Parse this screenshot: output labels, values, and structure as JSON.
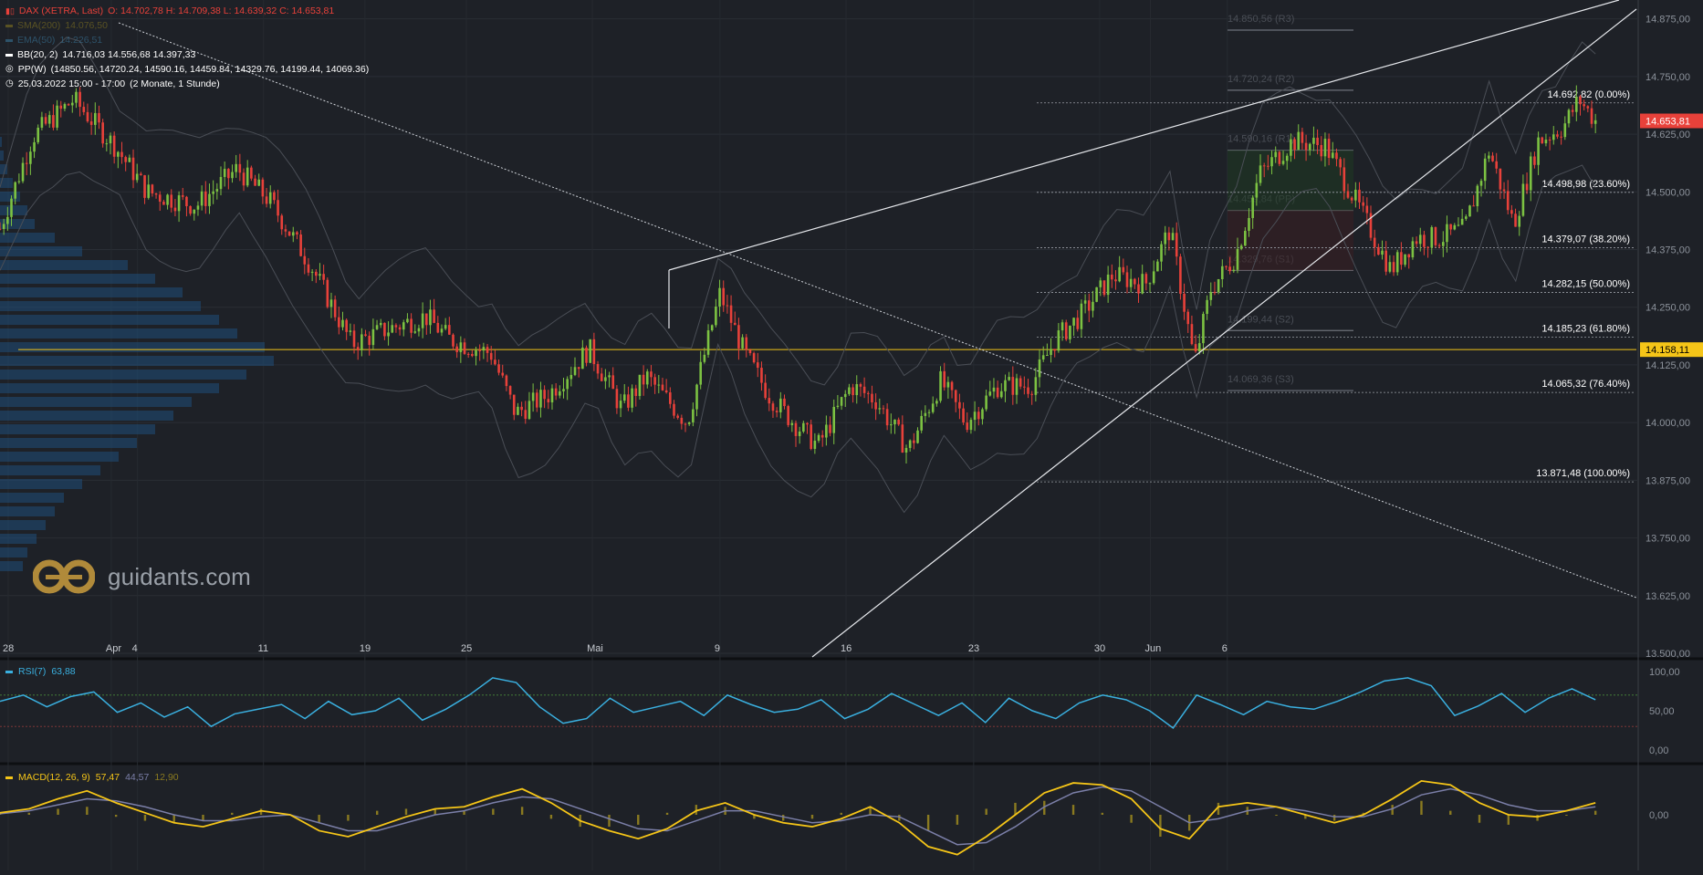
{
  "header": {
    "symbol_line": "DAX (XETRA, Last)",
    "ohlc": "O: 14.702,78  H: 14.709,38  L: 14.639,32  C: 14.653,81",
    "sma": {
      "label": "SMA(200)",
      "value": "14.076,50"
    },
    "ema": {
      "label": "EMA(50)",
      "value": "14.226,51"
    },
    "bb": {
      "label": "BB(20, 2)",
      "value": "14.716,03  14.556,68  14.397,33"
    },
    "pp": {
      "label": "PP(W)",
      "value": "(14850.56, 14720.24, 14590.16, 14459.84, 14329.76, 14199.44, 14069.36)"
    },
    "range": {
      "label": "25.03.2022 15:00 - 17:00",
      "value": "(2 Monate, 1 Stunde)"
    }
  },
  "logo": {
    "text": "guidants.com"
  },
  "colors": {
    "bg": "#1e2127",
    "up": "#7cc242",
    "down": "#e8413a",
    "accent": "#f5c518",
    "rsi": "#3ab0e0",
    "macd": "#f5c518",
    "signal": "#7b7fa8",
    "last_price": "#e8413a"
  },
  "chart_data": [
    {
      "type": "candlestick",
      "title": "DAX (XETRA, Last)",
      "ylim": [
        13500,
        14900
      ],
      "y_ticks": [
        "14.875,00",
        "14.750,00",
        "14.625,00",
        "14.500,00",
        "14.375,00",
        "14.250,00",
        "14.125,00",
        "14.000,00",
        "13.875,00",
        "13.750,00",
        "13.625,00",
        "13.500,00"
      ],
      "x_ticks": [
        {
          "label": "28",
          "pos": 0.005
        },
        {
          "label": "Apr",
          "pos": 0.068
        },
        {
          "label": "4",
          "pos": 0.084
        },
        {
          "label": "11",
          "pos": 0.161
        },
        {
          "label": "19",
          "pos": 0.223
        },
        {
          "label": "25",
          "pos": 0.285
        },
        {
          "label": "Mai",
          "pos": 0.362
        },
        {
          "label": "9",
          "pos": 0.44
        },
        {
          "label": "16",
          "pos": 0.517
        },
        {
          "label": "23",
          "pos": 0.595
        },
        {
          "label": "30",
          "pos": 0.672
        },
        {
          "label": "Jun",
          "pos": 0.703
        },
        {
          "label": "6",
          "pos": 0.75
        }
      ],
      "last_price": "14.653,81",
      "horizontal_level": "14.158,11",
      "fibonacci": [
        {
          "label": "14.692,82 (0.00%)",
          "value": 14692.82
        },
        {
          "label": "14.498,98 (23.60%)",
          "value": 14498.98
        },
        {
          "label": "14.379,07 (38.20%)",
          "value": 14379.07
        },
        {
          "label": "14.282,15 (50.00%)",
          "value": 14282.15
        },
        {
          "label": "14.185,23 (61.80%)",
          "value": 14185.23
        },
        {
          "label": "14.065,32 (76.40%)",
          "value": 14065.32
        },
        {
          "label": "13.871,48 (100.00%)",
          "value": 13871.48
        }
      ],
      "pivots": [
        {
          "label": "14.850,56 (R3)",
          "value": 14850.56
        },
        {
          "label": "14.720,24 (R2)",
          "value": 14720.24
        },
        {
          "label": "14.590,16 (R1)",
          "value": 14590.16
        },
        {
          "label": "14.459,84 (PP)",
          "value": 14459.84
        },
        {
          "label": "14.329,76 (S1)",
          "value": 14329.76
        },
        {
          "label": "14.199,44 (S2)",
          "value": 14199.44
        },
        {
          "label": "14.069,36 (S3)",
          "value": 14069.36
        }
      ],
      "series": [
        {
          "name": "Close",
          "points": [
            [
              0,
              14420
            ],
            [
              0.02,
              14620
            ],
            [
              0.045,
              14700
            ],
            [
              0.07,
              14600
            ],
            [
              0.09,
              14500
            ],
            [
              0.12,
              14470
            ],
            [
              0.145,
              14550
            ],
            [
              0.165,
              14480
            ],
            [
              0.19,
              14340
            ],
            [
              0.215,
              14170
            ],
            [
              0.235,
              14200
            ],
            [
              0.26,
              14230
            ],
            [
              0.275,
              14180
            ],
            [
              0.3,
              14150
            ],
            [
              0.315,
              14020
            ],
            [
              0.335,
              14060
            ],
            [
              0.36,
              14160
            ],
            [
              0.38,
              14030
            ],
            [
              0.395,
              14100
            ],
            [
              0.42,
              14000
            ],
            [
              0.44,
              14280
            ],
            [
              0.455,
              14150
            ],
            [
              0.47,
              14060
            ],
            [
              0.485,
              14000
            ],
            [
              0.5,
              13950
            ],
            [
              0.52,
              14080
            ],
            [
              0.535,
              14050
            ],
            [
              0.555,
              13940
            ],
            [
              0.575,
              14090
            ],
            [
              0.59,
              14000
            ],
            [
              0.61,
              14080
            ],
            [
              0.63,
              14080
            ],
            [
              0.645,
              14180
            ],
            [
              0.66,
              14230
            ],
            [
              0.68,
              14320
            ],
            [
              0.7,
              14300
            ],
            [
              0.715,
              14420
            ],
            [
              0.73,
              14130
            ],
            [
              0.74,
              14290
            ],
            [
              0.755,
              14360
            ],
            [
              0.77,
              14540
            ],
            [
              0.79,
              14610
            ],
            [
              0.81,
              14600
            ],
            [
              0.83,
              14470
            ],
            [
              0.85,
              14330
            ],
            [
              0.865,
              14400
            ],
            [
              0.88,
              14400
            ],
            [
              0.895,
              14420
            ],
            [
              0.91,
              14590
            ],
            [
              0.925,
              14430
            ],
            [
              0.94,
              14610
            ],
            [
              0.955,
              14640
            ],
            [
              0.965,
              14700
            ],
            [
              0.975,
              14654
            ]
          ]
        }
      ]
    },
    {
      "type": "line",
      "title": "RSI(7)",
      "value_label": "63,88",
      "ylim": [
        0,
        100
      ],
      "y_ticks": [
        "100,00",
        "50,00",
        "0,00"
      ],
      "series": [
        {
          "name": "RSI(7)",
          "values": [
            62,
            70,
            55,
            68,
            74,
            48,
            60,
            42,
            55,
            30,
            46,
            52,
            58,
            40,
            62,
            45,
            50,
            66,
            38,
            52,
            70,
            92,
            86,
            55,
            34,
            40,
            66,
            48,
            55,
            62,
            44,
            70,
            58,
            48,
            52,
            64,
            40,
            52,
            72,
            58,
            44,
            60,
            35,
            66,
            50,
            40,
            60,
            70,
            64,
            50,
            28,
            70,
            58,
            45,
            62,
            55,
            52,
            62,
            74,
            88,
            92,
            82,
            44,
            56,
            72,
            48,
            66,
            78,
            64
          ]
        }
      ]
    },
    {
      "type": "line",
      "title": "MACD(12, 26, 9)",
      "value_label": "57,47",
      "signal_label": "44,57",
      "hist_label": "12,90",
      "y_ticks": [
        "0,00"
      ],
      "series": [
        {
          "name": "MACD",
          "values": [
            10,
            30,
            80,
            120,
            60,
            10,
            -40,
            -60,
            -20,
            20,
            0,
            -80,
            -110,
            -60,
            -10,
            30,
            40,
            90,
            130,
            60,
            -30,
            -80,
            -120,
            -70,
            20,
            60,
            0,
            -40,
            -60,
            -20,
            40,
            -40,
            -160,
            -200,
            -110,
            0,
            110,
            160,
            150,
            80,
            -70,
            -120,
            40,
            60,
            40,
            0,
            -40,
            0,
            80,
            170,
            150,
            60,
            0,
            -10,
            20,
            60
          ]
        },
        {
          "name": "Signal",
          "values": [
            5,
            20,
            50,
            80,
            70,
            40,
            0,
            -30,
            -30,
            -10,
            0,
            -40,
            -80,
            -80,
            -40,
            0,
            20,
            60,
            90,
            80,
            30,
            -20,
            -70,
            -80,
            -30,
            20,
            20,
            -10,
            -40,
            -30,
            0,
            -10,
            -80,
            -150,
            -140,
            -60,
            40,
            110,
            140,
            120,
            40,
            -40,
            -20,
            20,
            40,
            20,
            -10,
            -10,
            30,
            100,
            130,
            100,
            50,
            20,
            20,
            40
          ]
        }
      ]
    }
  ]
}
